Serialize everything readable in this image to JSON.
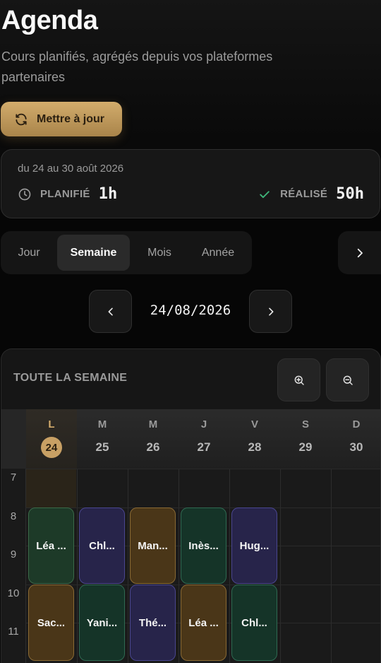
{
  "header": {
    "title": "Agenda",
    "subtitle": "Cours planifiés, agrégés depuis vos plateformes partenaires",
    "update_label": "Mettre à jour"
  },
  "summary": {
    "range": "du 24 au 30 août 2026",
    "planned_label": "PLANIFIÉ",
    "planned_value": "1h",
    "done_label": "RÉALISÉ",
    "done_value": "50h"
  },
  "tabs": [
    {
      "label": "Jour",
      "active": false
    },
    {
      "label": "Semaine",
      "active": true
    },
    {
      "label": "Mois",
      "active": false
    },
    {
      "label": "Année",
      "active": false
    }
  ],
  "date_nav": {
    "current": "24/08/2026"
  },
  "calendar": {
    "header_label": "TOUTE LA SEMAINE",
    "days": [
      {
        "letter": "L",
        "num": "24",
        "today": true
      },
      {
        "letter": "M",
        "num": "25",
        "today": false
      },
      {
        "letter": "M",
        "num": "26",
        "today": false
      },
      {
        "letter": "J",
        "num": "27",
        "today": false
      },
      {
        "letter": "V",
        "num": "28",
        "today": false
      },
      {
        "letter": "S",
        "num": "29",
        "today": false
      },
      {
        "letter": "D",
        "num": "30",
        "today": false
      }
    ],
    "hours": [
      "7",
      "8",
      "9",
      "10",
      "11"
    ],
    "events": [
      {
        "day": 0,
        "slot": 0,
        "label": "Léa ...",
        "color": "green"
      },
      {
        "day": 1,
        "slot": 0,
        "label": "Chl...",
        "color": "purple"
      },
      {
        "day": 2,
        "slot": 0,
        "label": "Man...",
        "color": "orange"
      },
      {
        "day": 3,
        "slot": 0,
        "label": "Inès...",
        "color": "teal"
      },
      {
        "day": 4,
        "slot": 0,
        "label": "Hug...",
        "color": "purple"
      },
      {
        "day": 0,
        "slot": 1,
        "label": "Sac...",
        "color": "orange"
      },
      {
        "day": 1,
        "slot": 1,
        "label": "Yani...",
        "color": "teal"
      },
      {
        "day": 2,
        "slot": 1,
        "label": "Thé...",
        "color": "purple"
      },
      {
        "day": 3,
        "slot": 1,
        "label": "Léa ...",
        "color": "orange"
      },
      {
        "day": 4,
        "slot": 1,
        "label": "Chl...",
        "color": "teal"
      }
    ]
  },
  "colors": {
    "accent": "#c8a064",
    "success": "#3fb57a"
  },
  "icons": {
    "update": "refresh-icon",
    "planned": "clock-icon",
    "done": "check-icon",
    "zoom_in": "zoom-in-icon",
    "zoom_out": "zoom-out-icon"
  }
}
